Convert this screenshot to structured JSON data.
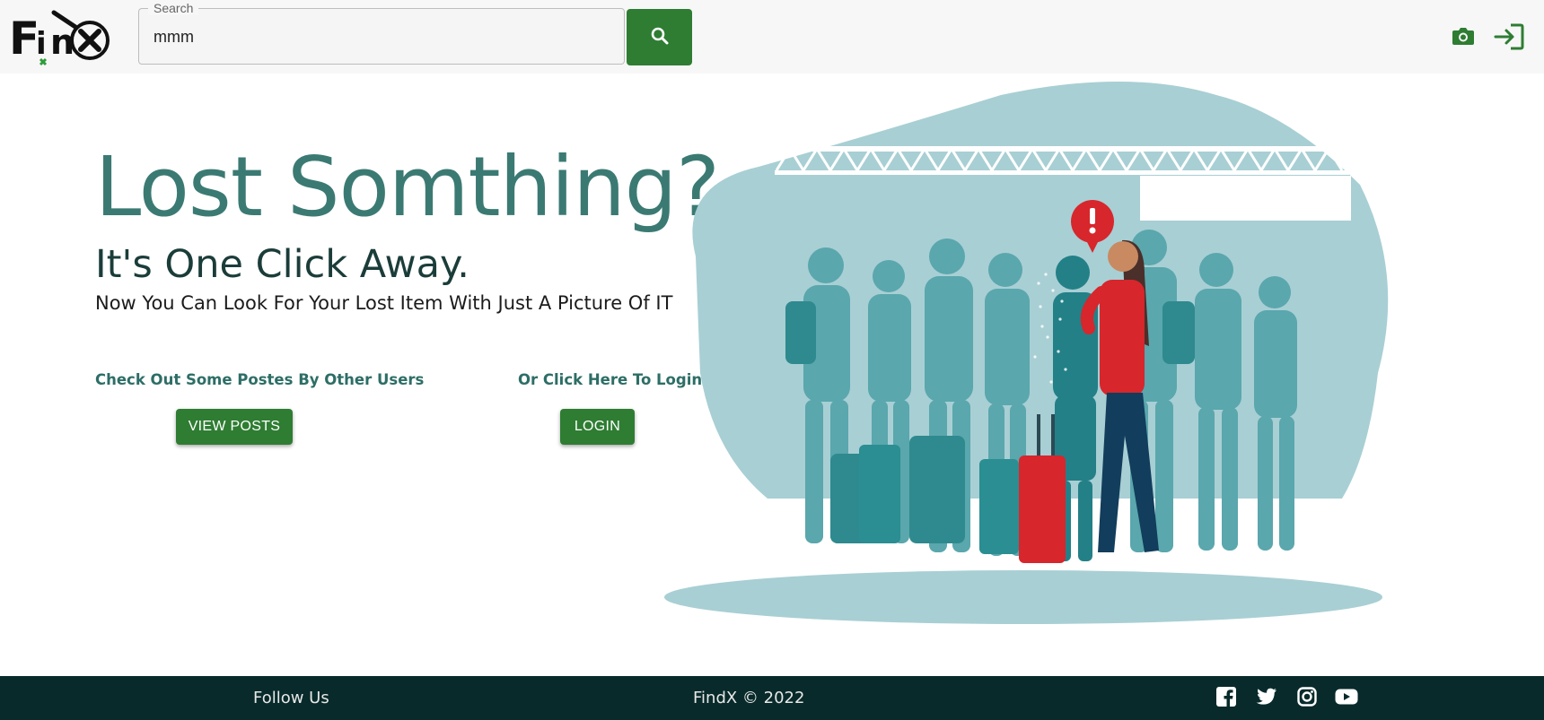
{
  "header": {
    "logo_text": "FinX",
    "search": {
      "label": "Search",
      "value": "mmm"
    },
    "icons": {
      "search": "search-icon",
      "camera": "camera-icon",
      "login": "login-icon"
    }
  },
  "hero": {
    "title": "Lost Somthing?",
    "subtitle": "It's One Click Away.",
    "description": "Now You Can Look For Your Lost Item With Just A Picture Of IT",
    "left_cta": {
      "label": "Check Out Some Postes By Other Users",
      "button": "VIEW POSTS"
    },
    "right_cta": {
      "label": "Or Click Here To Login",
      "button": "LOGIN"
    }
  },
  "footer": {
    "follow": "Follow Us",
    "copyright": "FindX © 2022",
    "social_icons": [
      "facebook-icon",
      "twitter-icon",
      "instagram-icon",
      "youtube-icon"
    ]
  },
  "colors": {
    "primary_green": "#2e7d32",
    "hero_teal": "#3b7a73",
    "footer_bg": "#082a2a"
  }
}
